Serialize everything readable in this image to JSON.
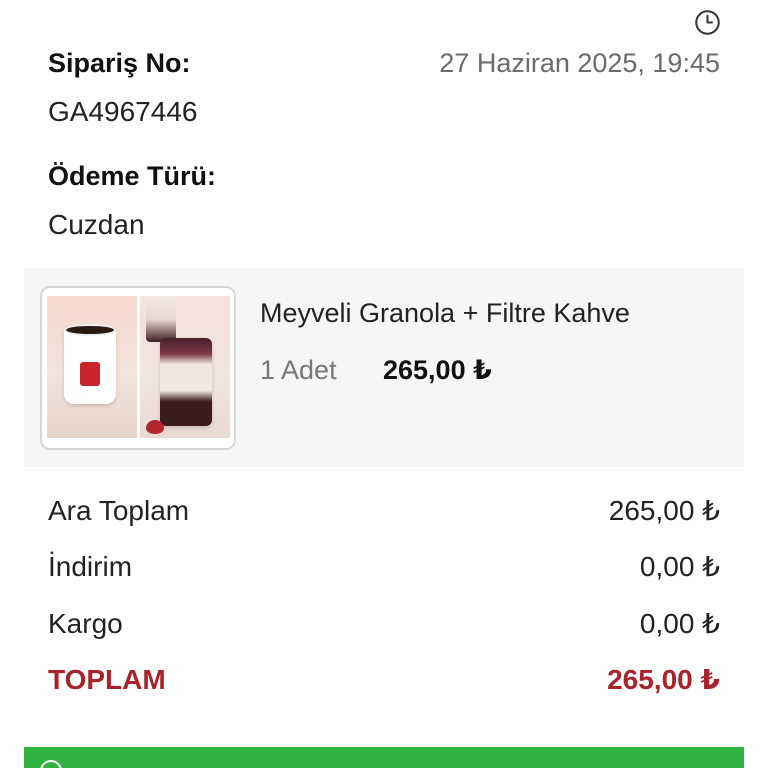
{
  "header": {
    "clock_icon": "clock-icon",
    "order_label": "Sipariş No:",
    "order_date": "27 Haziran 2025, 19:45",
    "order_no": "GA4967446"
  },
  "payment": {
    "label": "Ödeme Türü:",
    "value": "Cuzdan"
  },
  "item": {
    "name": "Meyveli Granola + Filtre Kahve",
    "quantity": "1 Adet",
    "price": "265,00 ₺"
  },
  "summary": {
    "subtotal_label": "Ara Toplam",
    "subtotal_value": "265,00 ₺",
    "discount_label": "İndirim",
    "discount_value": "0,00 ₺",
    "shipping_label": "Kargo",
    "shipping_value": "0,00 ₺",
    "total_label": "TOPLAM",
    "total_value": "265,00 ₺"
  },
  "colors": {
    "total_red": "#a8232a",
    "action_green": "#2fb23f"
  }
}
